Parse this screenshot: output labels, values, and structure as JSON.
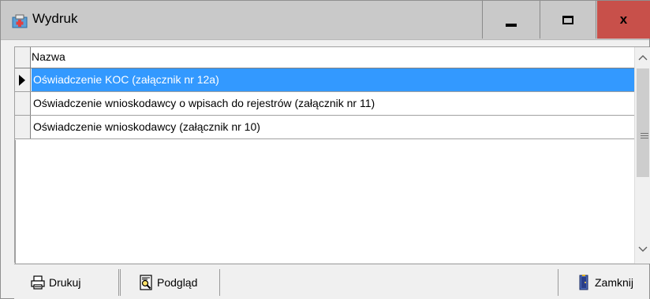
{
  "window": {
    "title": "Wydruk",
    "controls": {
      "close_glyph": "x"
    }
  },
  "grid": {
    "column_header": "Nazwa",
    "rows": [
      {
        "name": "Oświadczenie KOC (załącznik nr 12a)",
        "selected": true
      },
      {
        "name": "Oświadczenie wnioskodawcy o wpisach do rejestrów (załącznik nr 11)",
        "selected": false
      },
      {
        "name": "Oświadczenie wnioskodawcy (załącznik nr 10)",
        "selected": false
      }
    ]
  },
  "toolbar": {
    "print_label": "Drukuj",
    "preview_label": "Podgląd",
    "close_label": "Zamknij"
  },
  "colors": {
    "selection": "#3399ff",
    "close_button": "#c8504a",
    "titlebar": "#c9c9c9"
  }
}
